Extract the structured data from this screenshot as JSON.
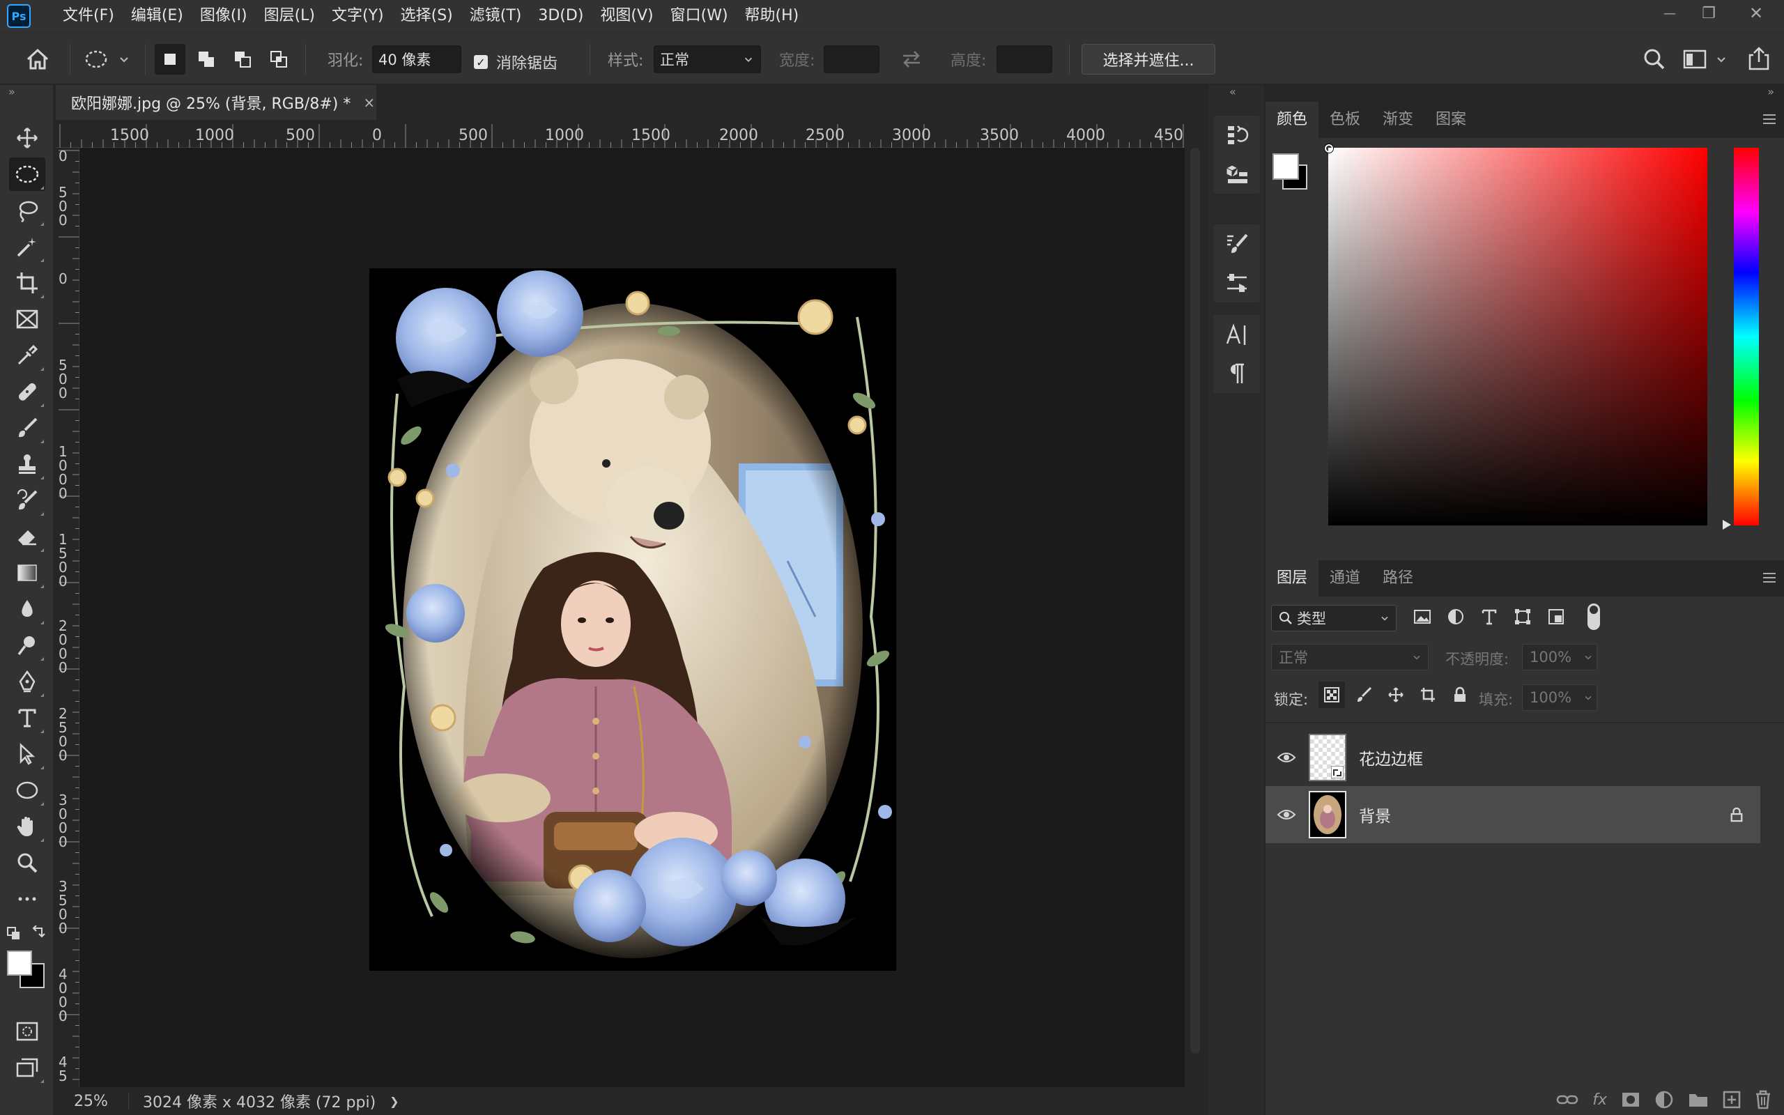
{
  "app": {
    "logo_text": "Ps"
  },
  "menu": [
    "文件(F)",
    "编辑(E)",
    "图像(I)",
    "图层(L)",
    "文字(Y)",
    "选择(S)",
    "滤镜(T)",
    "3D(D)",
    "视图(V)",
    "窗口(W)",
    "帮助(H)"
  ],
  "window_controls": {
    "minimize": "—",
    "restore": "❐",
    "close": "✕"
  },
  "options": {
    "feather_label": "羽化:",
    "feather_value": "40 像素",
    "antialias_label": "消除锯齿",
    "antialias_checked": true,
    "style_label": "样式:",
    "style_value": "正常",
    "width_label": "宽度:",
    "height_label": "高度:",
    "select_mask_button": "选择并遮住..."
  },
  "document": {
    "tab_title": "欧阳娜娜.jpg @ 25% (背景, RGB/8#) *",
    "close": "×"
  },
  "ruler_top": [
    "1500",
    "1000",
    "500",
    "0",
    "500",
    "1000",
    "1500",
    "2000",
    "2500",
    "3000",
    "3500",
    "4000",
    "450"
  ],
  "ruler_left": [
    "0",
    "500",
    "0",
    "500",
    "1000",
    "1500",
    "2000",
    "2500",
    "3000",
    "3500",
    "4000",
    "45"
  ],
  "status": {
    "zoom": "25%",
    "doc_info": "3024 像素 x 4032 像素 (72 ppi)",
    "arrow": "❯"
  },
  "color_panel": {
    "tabs": [
      "颜色",
      "色板",
      "渐变",
      "图案"
    ],
    "active_tab": 0,
    "foreground": "#ffffff",
    "background": "#000000",
    "hue_color": "#ff0000"
  },
  "layers_panel": {
    "tabs": [
      "图层",
      "通道",
      "路径"
    ],
    "active_tab": 0,
    "filter_kind": "类型",
    "blend_mode": "正常",
    "opacity_label": "不透明度:",
    "opacity_value": "100%",
    "lock_label": "锁定:",
    "fill_label": "填充:",
    "fill_value": "100%",
    "layers": [
      {
        "name": "花边边框",
        "visible": true,
        "locked": false,
        "selected": false
      },
      {
        "name": "背景",
        "visible": true,
        "locked": true,
        "selected": true
      }
    ]
  },
  "icons": {
    "home": "home-icon",
    "marquee": "elliptical-marquee-icon",
    "search": "search-icon",
    "share": "share-icon"
  }
}
